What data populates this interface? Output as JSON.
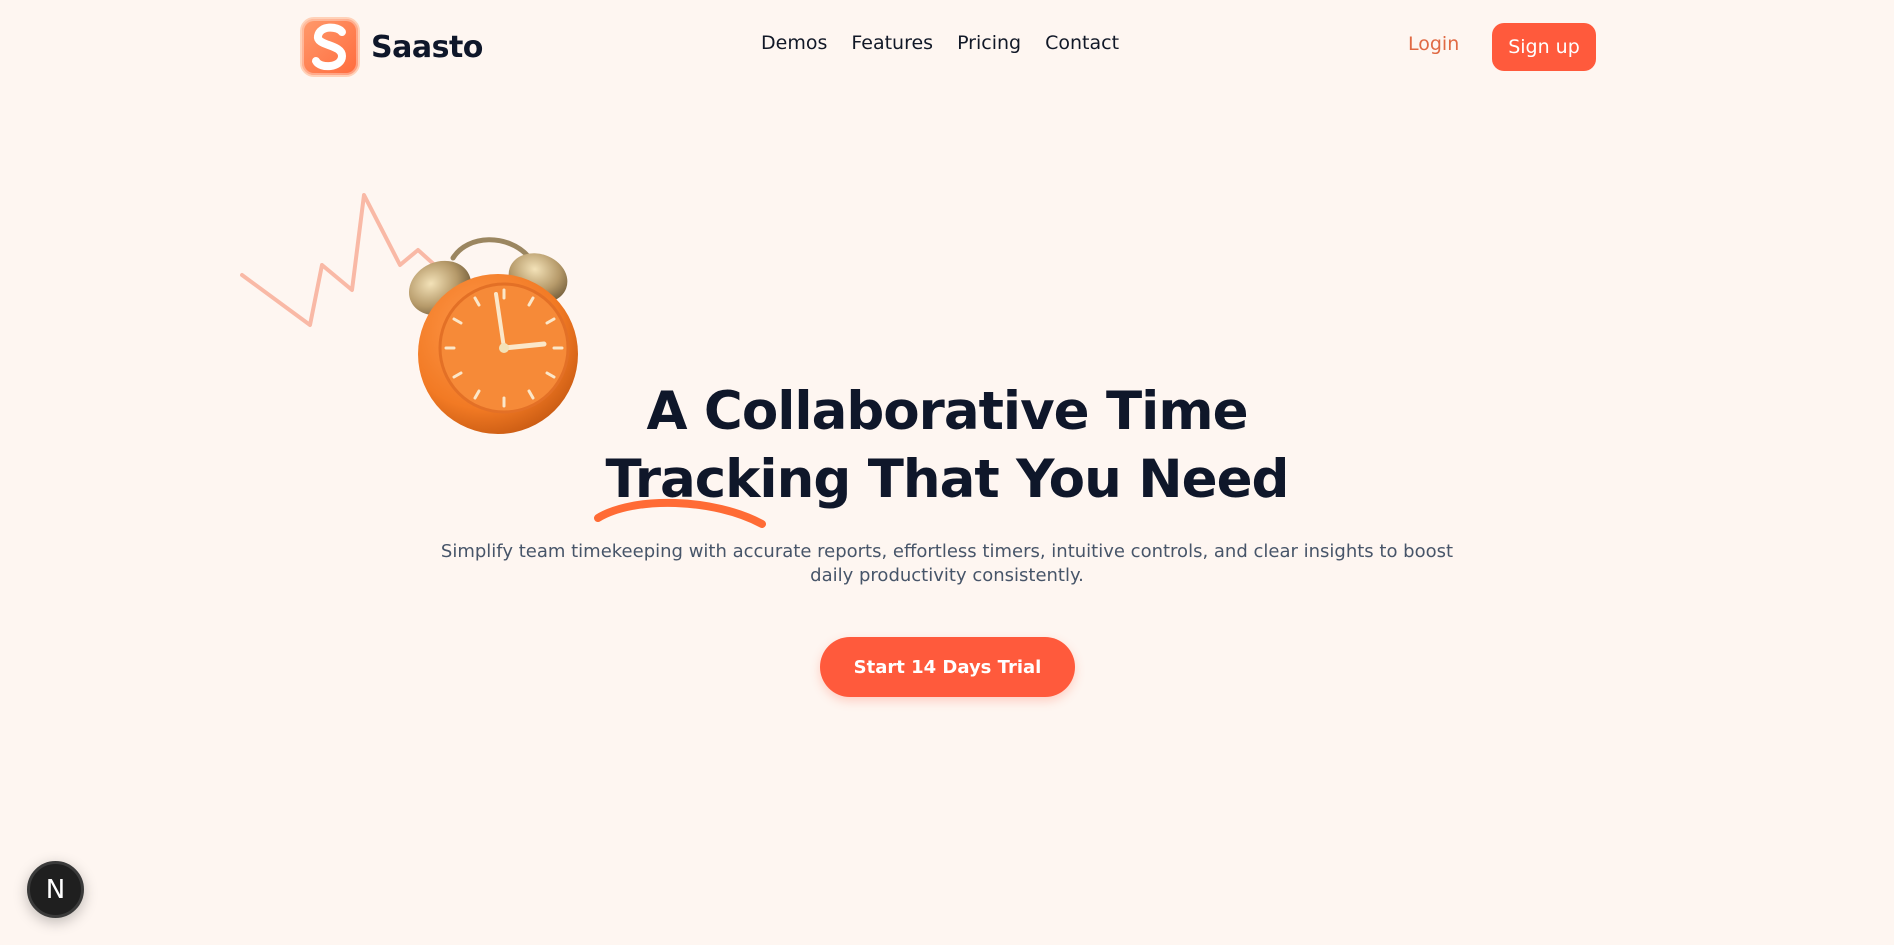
{
  "brand": {
    "name": "Saasto",
    "logo_letter": "S",
    "accent_color": "#FF5A3C",
    "background_color": "#FEF6F1"
  },
  "nav": {
    "items": [
      {
        "label": "Demos"
      },
      {
        "label": "Features"
      },
      {
        "label": "Pricing"
      },
      {
        "label": "Contact"
      }
    ]
  },
  "auth": {
    "login_label": "Login",
    "signup_label": "Sign up"
  },
  "hero": {
    "headline_line1": "A Collaborative Time",
    "headline_line2": "Tracking That You Need",
    "subtitle": "Simplify team timekeeping with accurate reports, effortless timers, intuitive controls, and clear insights to boost daily productivity consistently.",
    "cta_label": "Start 14 Days Trial",
    "illustration": "alarm-clock-icon",
    "decoration": "zigzag-line"
  },
  "floating_badge": {
    "letter": "N",
    "icon": "nextjs-icon"
  }
}
